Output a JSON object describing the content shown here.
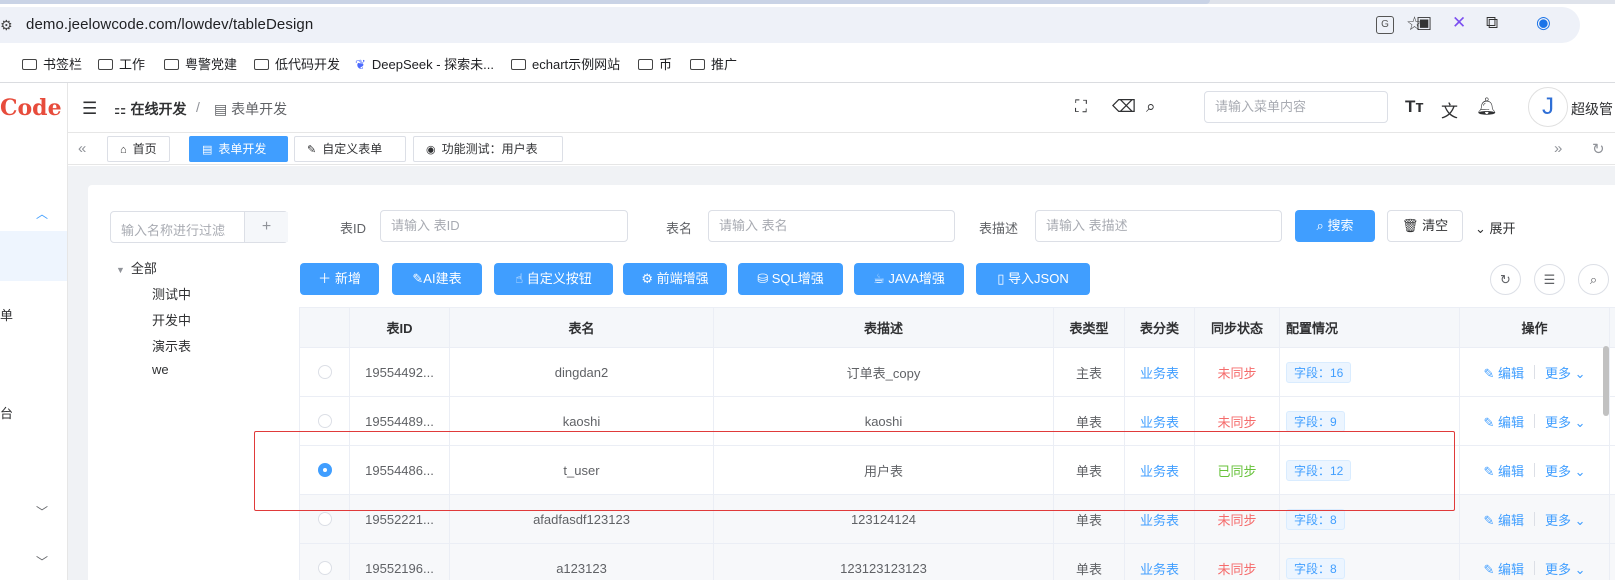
{
  "browser": {
    "url": "demo.jeelowcode.com/lowdev/tableDesign",
    "bookmarks": [
      "书签栏",
      "工作",
      "粤警党建",
      "低代码开发",
      "DeepSeek - 探索未...",
      "echart示例网站",
      "币",
      "推广"
    ]
  },
  "sidebar": {
    "logo": "Code",
    "items": [
      "单",
      "台"
    ]
  },
  "header": {
    "breadcrumb_root": "在线开发",
    "breadcrumb_sep": "/",
    "breadcrumb_current": "表单开发",
    "search_placeholder": "请输入菜单内容",
    "user_name": "超级管"
  },
  "tabs": [
    {
      "label": "首页",
      "active": false
    },
    {
      "label": "表单开发",
      "active": true
    },
    {
      "label": "自定义表单",
      "active": false
    },
    {
      "label": "功能测试：用户表",
      "active": false
    }
  ],
  "tree": {
    "filter_placeholder": "输入名称进行过滤",
    "add_label": "+",
    "root": "全部",
    "children": [
      "测试中",
      "开发中",
      "演示表",
      "we"
    ]
  },
  "search_form": {
    "table_id_label": "表ID",
    "table_id_placeholder": "请输入 表ID",
    "table_name_label": "表名",
    "table_name_placeholder": "请输入 表名",
    "table_desc_label": "表描述",
    "table_desc_placeholder": "请输入 表描述",
    "search_button": "搜索",
    "clear_button": "清空",
    "expand_label": "展开"
  },
  "toolbar": {
    "buttons": [
      "新增",
      "AI建表",
      "自定义按钮",
      "前端增强",
      "SQL增强",
      "JAVA增强",
      "导入JSON"
    ]
  },
  "table": {
    "columns": [
      "表ID",
      "表名",
      "表描述",
      "表类型",
      "表分类",
      "同步状态",
      "配置情况",
      "操作"
    ],
    "edit_label": "编辑",
    "more_label": "更多",
    "rows": [
      {
        "id": "19554492...",
        "name": "dingdan2",
        "desc": "订单表_copy",
        "type": "主表",
        "category": "业务表",
        "sync": "未同步",
        "fields": "字段：16",
        "selected": false
      },
      {
        "id": "19554489...",
        "name": "kaoshi",
        "desc": "kaoshi",
        "type": "单表",
        "category": "业务表",
        "sync": "未同步",
        "fields": "字段：9",
        "selected": false
      },
      {
        "id": "19554486...",
        "name": "t_user",
        "desc": "用户表",
        "type": "单表",
        "category": "业务表",
        "sync": "已同步",
        "fields": "字段：12",
        "selected": true
      },
      {
        "id": "19552221...",
        "name": "afadfasdf123123",
        "desc": "123124124",
        "type": "单表",
        "category": "业务表",
        "sync": "未同步",
        "fields": "字段：8",
        "selected": false
      },
      {
        "id": "19552196...",
        "name": "a123123",
        "desc": "123123123123",
        "type": "单表",
        "category": "业务表",
        "sync": "未同步",
        "fields": "字段：8",
        "selected": false
      }
    ]
  },
  "colors": {
    "primary": "#409eff",
    "unsynced": "#f56c6c",
    "synced": "#67c23a",
    "highlight": "#e03a3a"
  }
}
